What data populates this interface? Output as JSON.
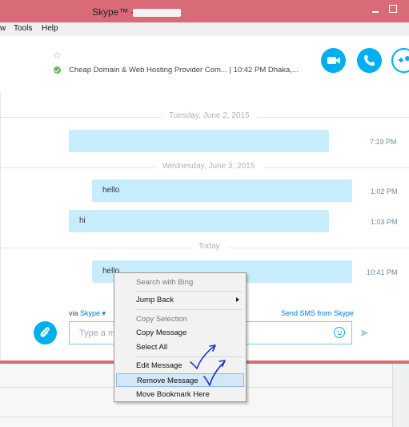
{
  "window": {
    "title": "Skype™ - "
  },
  "menubar": {
    "items": [
      "w",
      "Tools",
      "Help"
    ]
  },
  "header": {
    "mood": "Cheap Domain & Web Hosting Provider Com...  |  10:42 PM Dhaka,..."
  },
  "chat": {
    "dates": [
      "Tuesday, June 2, 2015",
      "Wednesday, June 3, 2015",
      "Today"
    ],
    "messages": [
      {
        "text": "",
        "time": "7:19 PM"
      },
      {
        "text": "hello",
        "time": "1:02 PM"
      },
      {
        "text": "hi",
        "time": "1:03 PM"
      },
      {
        "text": "hello",
        "time": "10:41 PM"
      }
    ]
  },
  "compose": {
    "via_prefix": "via",
    "via_service": "Skype ▾",
    "sms_link": "Send SMS from Skype",
    "placeholder": "Type a m"
  },
  "context_menu": {
    "search": "Search with Bing",
    "jump_back": "Jump Back",
    "copy_selection": "Copy Selection",
    "copy_message": "Copy Message",
    "select_all": "Select All",
    "edit_message": "Edit Message",
    "remove_message": "Remove Message",
    "move_bookmark": "Move Bookmark Here"
  },
  "colors": {
    "accent": "#00aff0",
    "titlebar": "#d96b78",
    "bubble": "#c7ecfb",
    "online": "#5cb85c",
    "ink": "#1f33c9"
  },
  "icons": [
    "star-icon",
    "video-call-icon",
    "phone-icon",
    "add-contact-icon",
    "paperclip-icon",
    "emoji-icon",
    "send-icon"
  ]
}
